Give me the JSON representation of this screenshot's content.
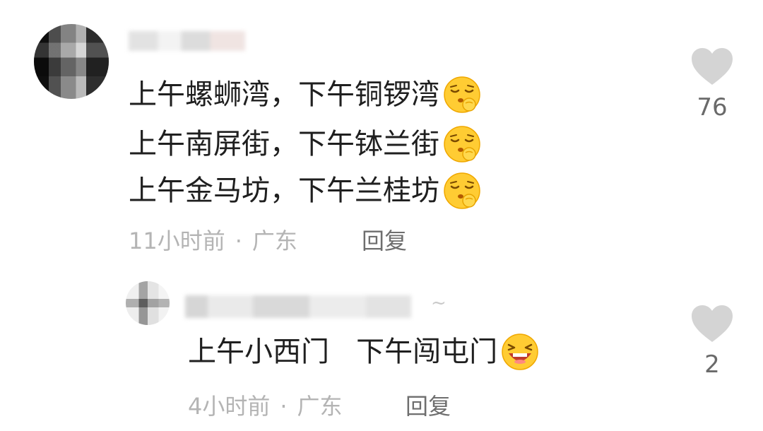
{
  "comment": {
    "lines": [
      "上午螺蛳湾，下午铜锣湾",
      "上午南屏街，下午钵兰街",
      "上午金马坊，下午兰桂坊"
    ],
    "line_emoji": "shushing-face-emoji",
    "time": "11小时前",
    "separator": "·",
    "location": "广东",
    "reply_label": "回复",
    "like_count": "76"
  },
  "reply": {
    "text": "上午小西门   下午闯屯门",
    "emoji": "laughing-face-emoji",
    "time": "4小时前",
    "separator": "·",
    "location": "广东",
    "reply_label": "回复",
    "like_count": "2",
    "name_suffix": "~"
  },
  "colors": {
    "text": "#1f1f1f",
    "meta": "#b4b4b4",
    "reply_button": "#6e6e6e",
    "heart": "#d4d4d4",
    "emoji_yellow": "#ffcc33"
  }
}
